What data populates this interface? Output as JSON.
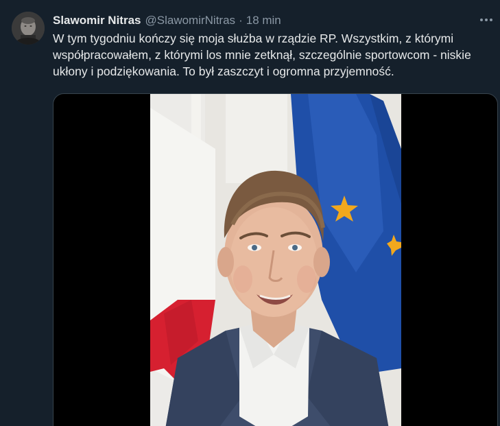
{
  "author": {
    "display_name": "Slawomir Nitras",
    "handle": "@SlawomirNitras",
    "separator": "·",
    "timestamp": "18 min"
  },
  "icons": {
    "more": "more-horizontal-icon",
    "avatar": "profile-photo"
  },
  "tweet": {
    "text": "W tym tygodniu kończy się moja służba w rządzie RP. Wszystkim, z którymi współpracowałem, z którymi los mnie zetknął, szczególnie sportowcom - niskie ukłony i podziękowania. To był zaszczyt i ogromna przyjemność."
  },
  "media": {
    "type": "video",
    "content": "man speaking in front of Polish and EU flags"
  },
  "colors": {
    "background": "#15202b",
    "text": "#e7e9ea",
    "secondary_text": "#8b98a5",
    "media_border": "#38444d",
    "eu_blue": "#1f4fa8",
    "eu_star": "#f2a81d",
    "polish_red": "#d62030"
  }
}
